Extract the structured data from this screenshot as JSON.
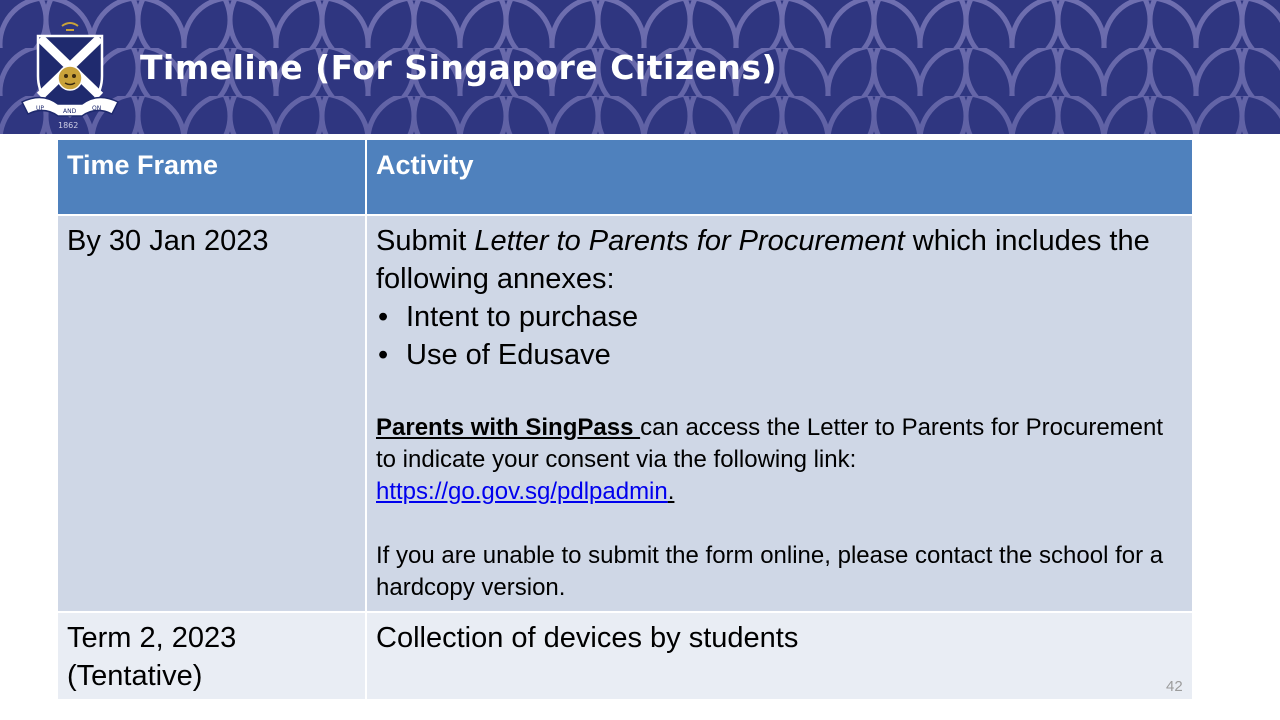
{
  "header": {
    "title": "Timeline (For Singapore Citizens)",
    "crest": {
      "motto": [
        "UP",
        "AND",
        "ON"
      ],
      "year": "1862"
    },
    "banner_color": "#2f3680"
  },
  "table": {
    "header_color": "#4f81bd",
    "columns": [
      "Time Frame",
      "Activity"
    ],
    "rows": [
      {
        "time_frame": "By 30 Jan 2023",
        "activity": {
          "intro_prefix": "Submit ",
          "intro_italic": "Letter to Parents for Procurement",
          "intro_suffix": " which includes the following annexes:",
          "annexes": [
            "Intent to purchase",
            "Use of Edusave"
          ],
          "singpass_label": "Parents with SingPass ",
          "singpass_text": "can access the Letter to Parents for Procurement to indicate your consent via the following link:",
          "link": "https://go.gov.sg/pdlpadmin",
          "link_suffix": ".",
          "contact_note": "If you are unable to submit the form online, please contact the school for a hardcopy version."
        }
      },
      {
        "time_frame_line1": "Term 2, 2023",
        "time_frame_line2": "(Tentative)",
        "activity": "Collection of devices by students"
      }
    ]
  },
  "page_number": "42"
}
